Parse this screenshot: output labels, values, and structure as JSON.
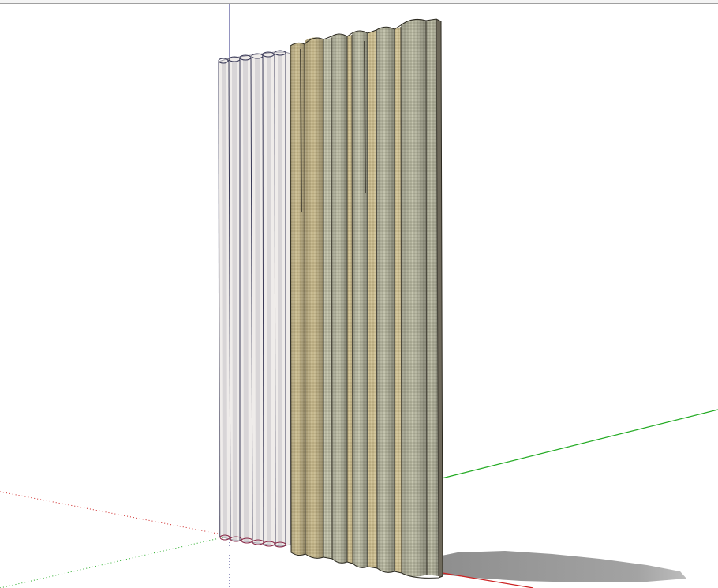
{
  "window": {
    "title": ""
  },
  "scene": {
    "background_color": "#ffffff",
    "axes": {
      "red_axis_color": "#cc2222",
      "green_axis_color": "#22aa22",
      "blue_axis_color": "#2a2a80"
    },
    "model": {
      "panel_color": "#c9ba8a",
      "panel_alt_color": "#b8b8a4",
      "ghost_color": "#efecea",
      "ghost_outline_color": "#3a3a58",
      "shadow_color": "#9a9a9a"
    }
  }
}
